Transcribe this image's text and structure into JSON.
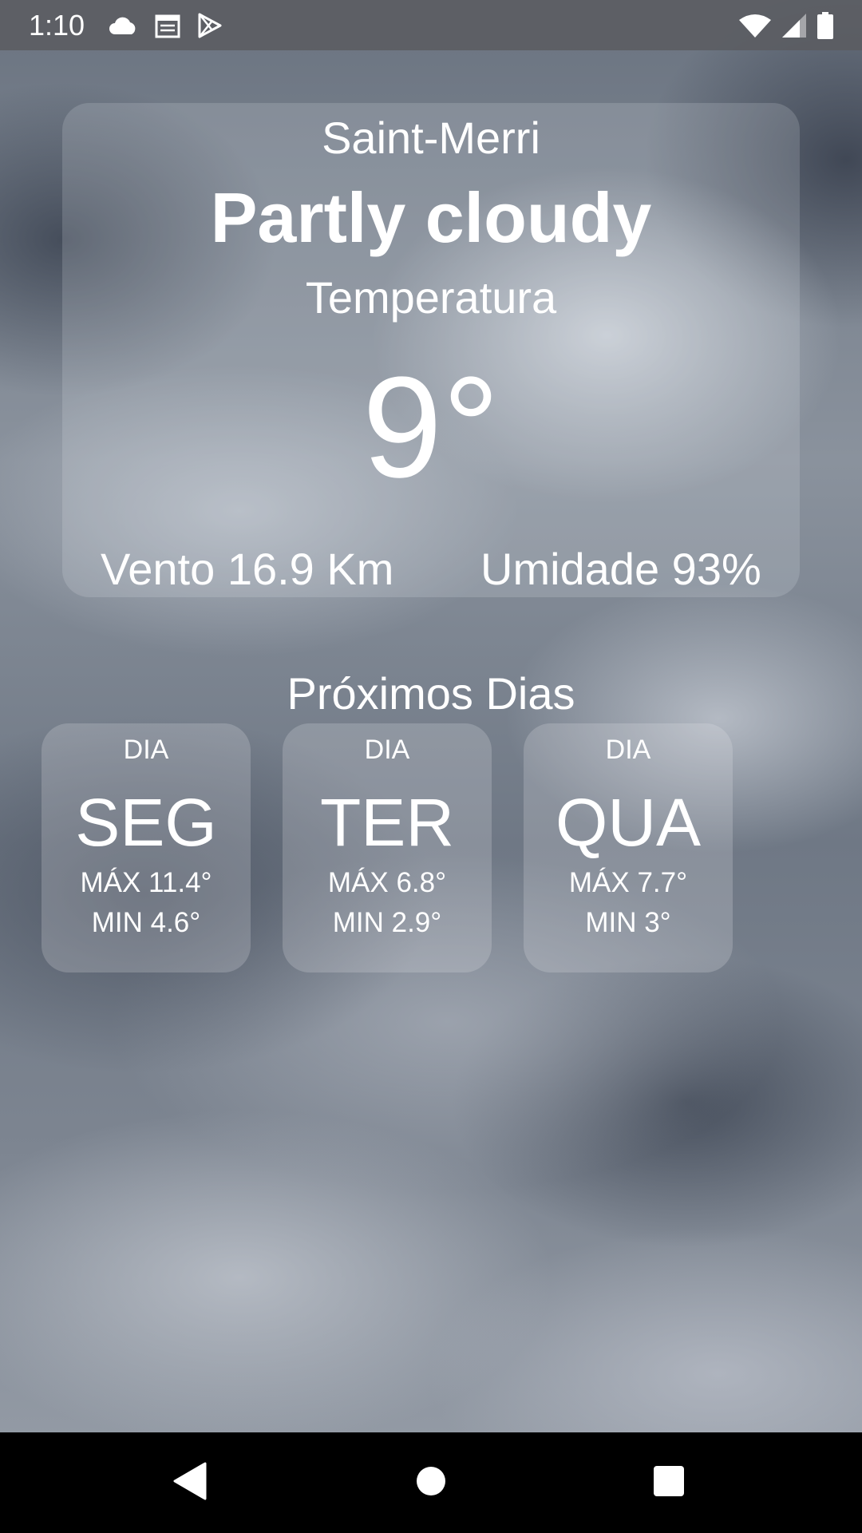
{
  "status_bar": {
    "time": "1:10",
    "left_icons": [
      "cloud-icon",
      "calendar-icon",
      "play-store-icon"
    ],
    "right_icons": [
      "wifi-icon",
      "signal-icon",
      "battery-icon"
    ]
  },
  "current": {
    "city": "Saint-Merri",
    "condition": "Partly cloudy",
    "temperature_label": "Temperatura",
    "temperature": "9°",
    "wind": "Vento 16.9 Km",
    "humidity": "Umidade 93%"
  },
  "forecast": {
    "title": "Próximos Dias",
    "days": [
      {
        "label": "DIA",
        "name": "SEG",
        "max": "MÁX 11.4°",
        "min": "MIN 4.6°"
      },
      {
        "label": "DIA",
        "name": "TER",
        "max": "MÁX 6.8°",
        "min": "MIN 2.9°"
      },
      {
        "label": "DIA",
        "name": "QUA",
        "max": "MÁX 7.7°",
        "min": "MIN 3°"
      }
    ]
  },
  "nav_bar": {
    "buttons": [
      "back-icon",
      "home-icon",
      "recents-icon"
    ]
  }
}
